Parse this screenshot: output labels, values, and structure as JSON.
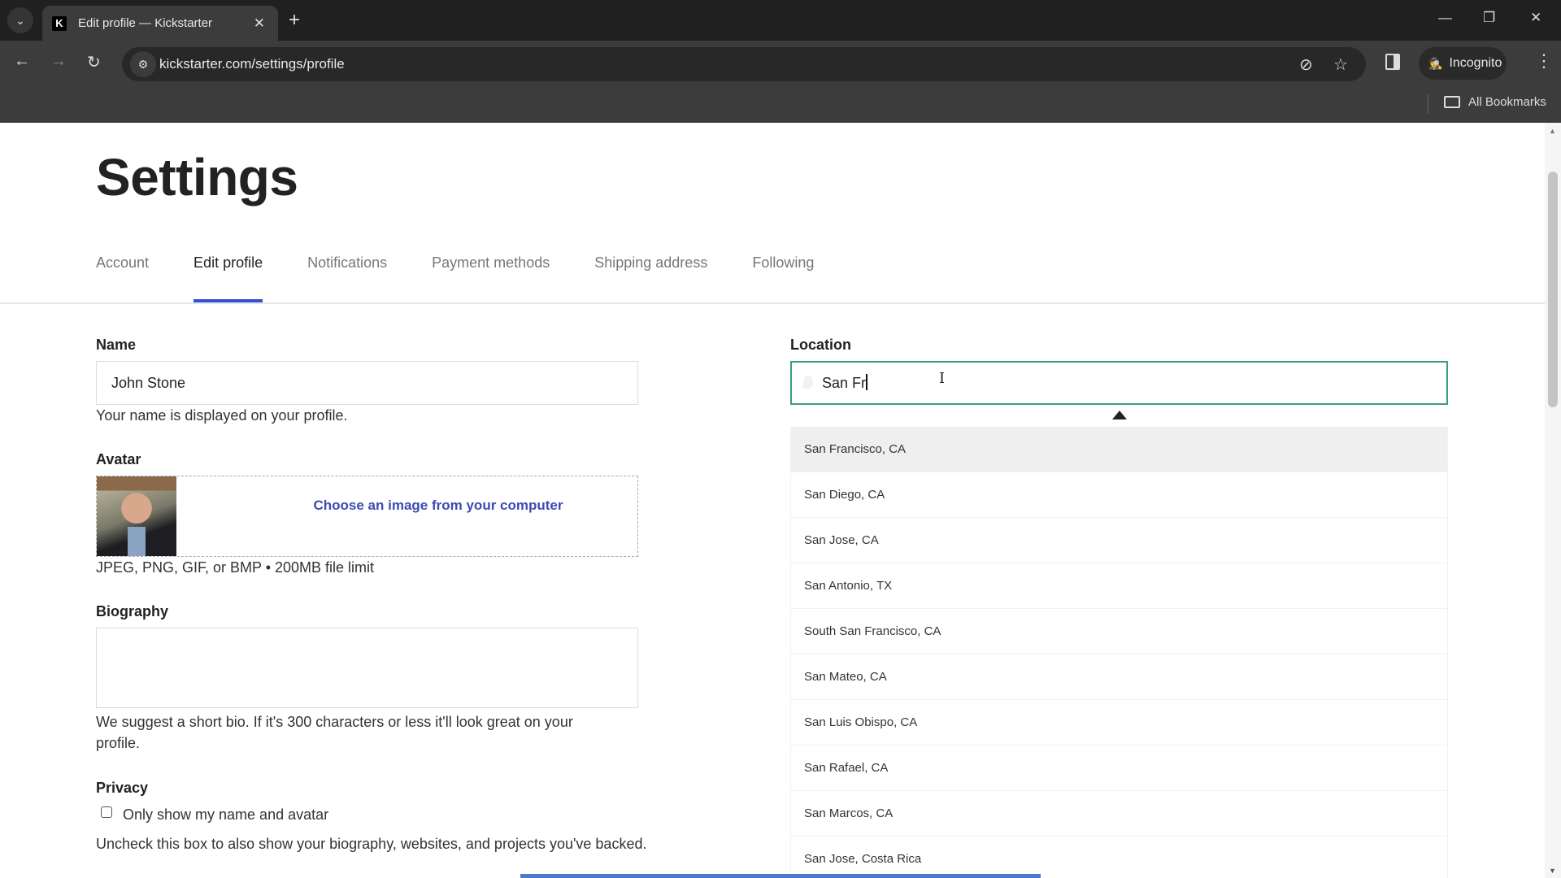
{
  "browser": {
    "tab_title": "Edit profile — Kickstarter",
    "url": "kickstarter.com/settings/profile",
    "incognito_label": "Incognito",
    "bookmarks_label": "All Bookmarks",
    "icons": {
      "tab_list": "⌄",
      "close_tab": "✕",
      "new_tab": "+",
      "minimize": "—",
      "maximize": "❐",
      "close_window": "✕",
      "back": "←",
      "forward": "→",
      "reload": "↻",
      "site_info": "⚙",
      "eye_off": "⊘",
      "star": "☆",
      "incognito": "🕵",
      "menu": "⋮"
    }
  },
  "page": {
    "title": "Settings",
    "tabs": [
      {
        "label": "Account",
        "active": false
      },
      {
        "label": "Edit profile",
        "active": true
      },
      {
        "label": "Notifications",
        "active": false
      },
      {
        "label": "Payment methods",
        "active": false
      },
      {
        "label": "Shipping address",
        "active": false
      },
      {
        "label": "Following",
        "active": false
      }
    ],
    "name": {
      "label": "Name",
      "value": "John Stone",
      "hint": "Your name is displayed on your profile."
    },
    "avatar": {
      "label": "Avatar",
      "choose_link": "Choose an image from your computer",
      "hint": "JPEG, PNG, GIF, or BMP • 200MB file limit"
    },
    "biography": {
      "label": "Biography",
      "value": "",
      "hint": "We suggest a short bio. If it's 300 characters or less it'll look great on your profile."
    },
    "privacy": {
      "label": "Privacy",
      "checkbox_label": "Only show my name and avatar",
      "checked": false,
      "hint": "Uncheck this box to also show your biography, websites, and projects you've backed."
    },
    "location": {
      "label": "Location",
      "value": "San Fr",
      "suggestions": [
        "San Francisco, CA",
        "San Diego, CA",
        "San Jose, CA",
        "San Antonio, TX",
        "South San Francisco, CA",
        "San Mateo, CA",
        "San Luis Obispo, CA",
        "San Rafael, CA",
        "San Marcos, CA",
        "San Jose, Costa Rica"
      ],
      "highlighted_index": 0
    }
  }
}
